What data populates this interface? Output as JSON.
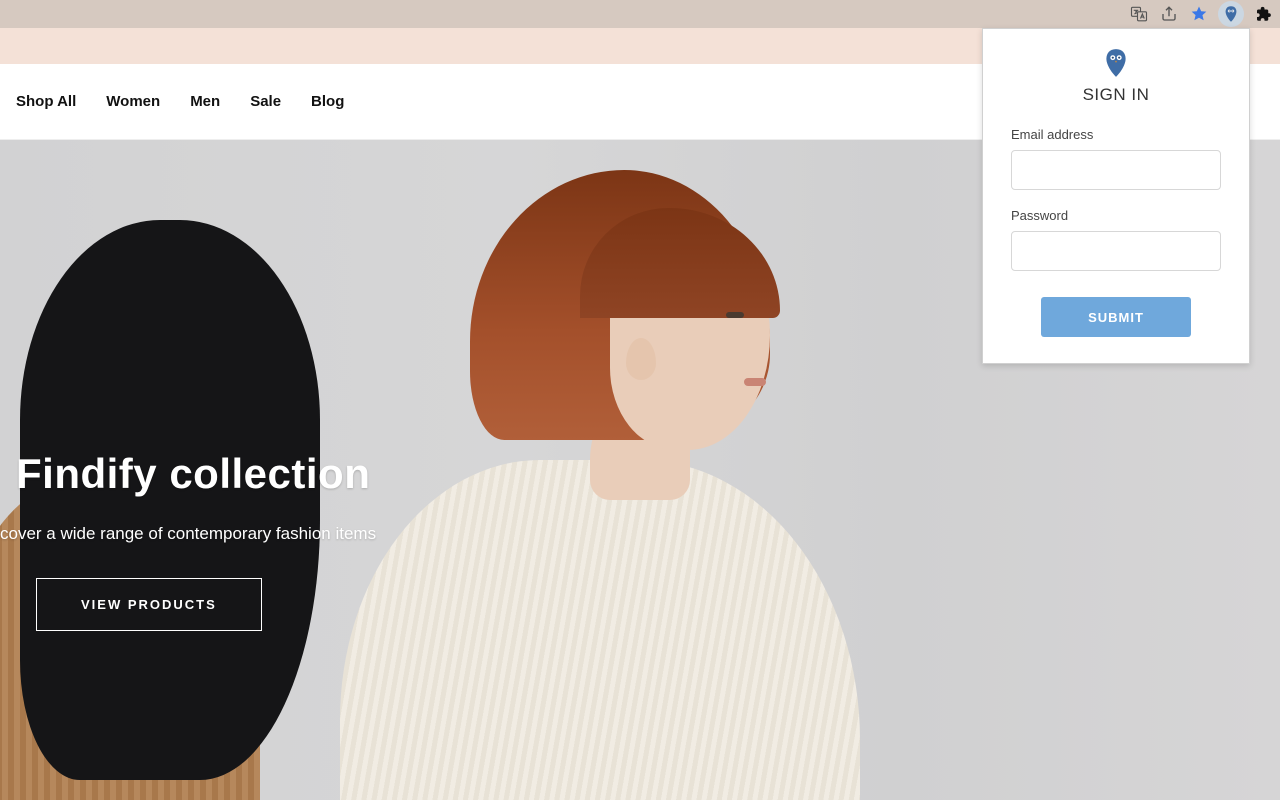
{
  "browser": {
    "icons": [
      "translate",
      "share",
      "star",
      "owl-extension",
      "extensions"
    ]
  },
  "nav": {
    "items": [
      {
        "label": "Shop All"
      },
      {
        "label": "Women"
      },
      {
        "label": "Men"
      },
      {
        "label": "Sale"
      },
      {
        "label": "Blog"
      }
    ]
  },
  "hero": {
    "title": "Findify collection",
    "subtitle": "cover a wide range of contemporary fashion items",
    "button_label": "VIEW PRODUCTS"
  },
  "extension_popup": {
    "title": "SIGN IN",
    "email_label": "Email address",
    "email_value": "",
    "password_label": "Password",
    "password_value": "",
    "submit_label": "SUBMIT"
  },
  "colors": {
    "peach_band": "#f4e1d7",
    "submit_button": "#6fa8dc",
    "star": "#3b78e7"
  }
}
